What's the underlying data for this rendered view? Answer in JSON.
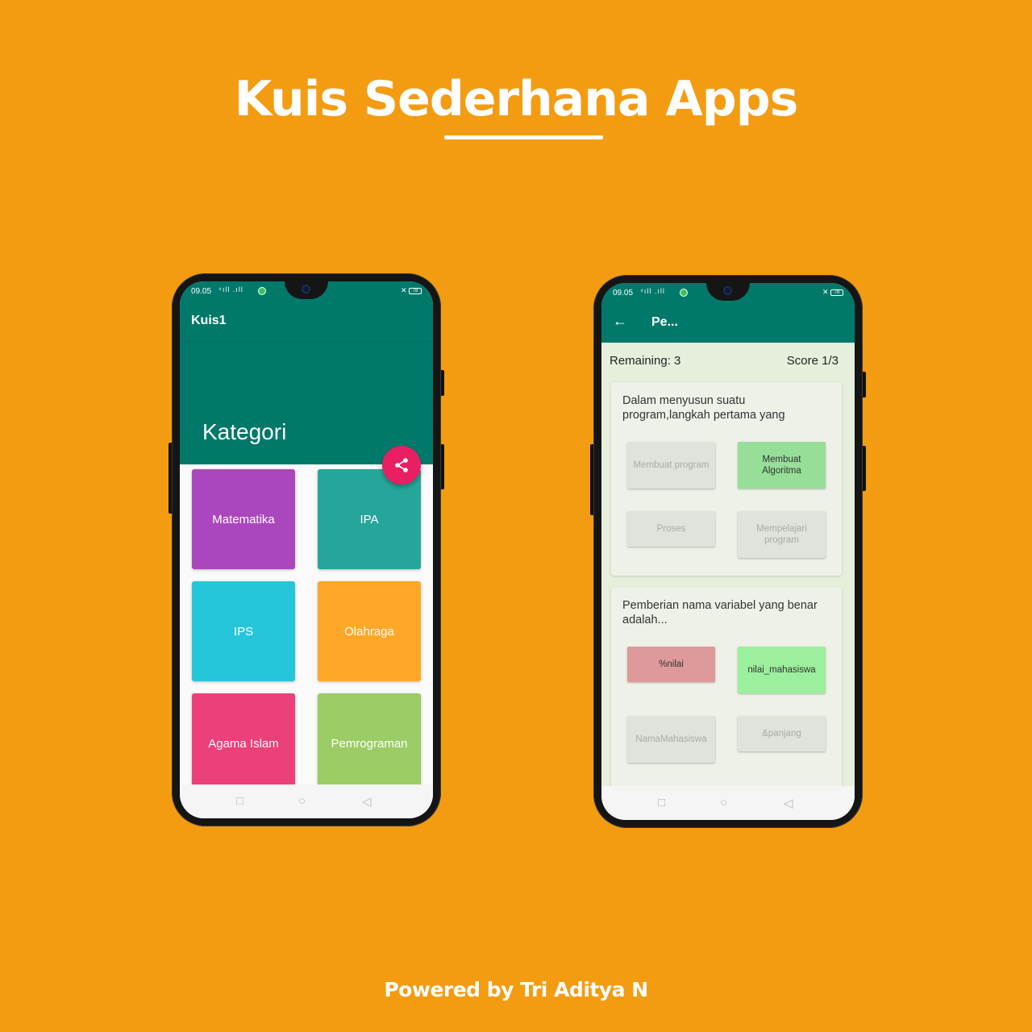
{
  "promo": {
    "headline": "Kuis Sederhana Apps",
    "footer": "Powered by Tri Aditya N"
  },
  "status_bar": {
    "time": "09.05",
    "signal": "⁴ıll .ıll",
    "battery": "78"
  },
  "screen1": {
    "app_title": "Kuis1",
    "header": "Kategori",
    "share_icon": "share-icon",
    "categories": [
      {
        "label": "Matematika",
        "color": "#AB47BC"
      },
      {
        "label": "IPA",
        "color": "#26A69A"
      },
      {
        "label": "IPS",
        "color": "#26C6DA"
      },
      {
        "label": "Olahraga",
        "color": "#FFA726"
      },
      {
        "label": "Agama Islam",
        "color": "#EC407A"
      },
      {
        "label": "Pemrograman",
        "color": "#9CCC65"
      }
    ]
  },
  "screen2": {
    "app_title": "Pe...",
    "back_icon": "arrow-left-icon",
    "remaining": "Remaining: 3",
    "score": "Score 1/3",
    "questions": [
      {
        "text": "Dalam menyusun suatu program,langkah pertama yang",
        "options": [
          "Membuat program",
          "Membuat Algoritma",
          "Proses",
          "Mempelajari program"
        ]
      },
      {
        "text": "Pemberian nama variabel yang benar adalah...",
        "options": [
          "%nilai",
          "nilai_mahasiswa",
          "NamaMahasiswa",
          "&panjang"
        ]
      }
    ]
  },
  "nav_icons": [
    "square-icon",
    "circle-icon",
    "back-triangle-icon"
  ],
  "colors": {
    "background": "#F39C12",
    "primary": "#00796B",
    "accent": "#E91E63"
  }
}
